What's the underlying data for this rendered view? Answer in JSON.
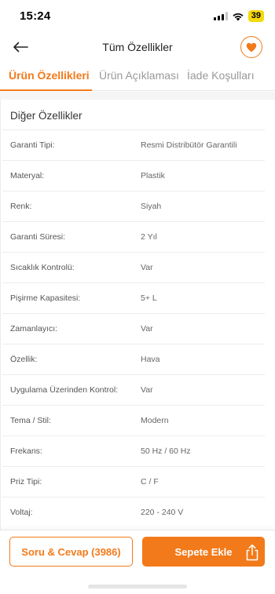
{
  "status_bar": {
    "time": "15:24",
    "battery": "39"
  },
  "header": {
    "title": "Tüm Özellikler"
  },
  "tabs": [
    {
      "label": "Ürün Özellikleri",
      "active": true
    },
    {
      "label": "Ürün Açıklaması",
      "active": false
    },
    {
      "label": "İade Koşulları",
      "active": false
    }
  ],
  "section": {
    "title": "Diğer Özellikler",
    "rows": [
      {
        "label": "Garanti Tipi:",
        "value": "Resmi Distribütör Garantili"
      },
      {
        "label": "Materyal:",
        "value": "Plastik"
      },
      {
        "label": "Renk:",
        "value": "Siyah"
      },
      {
        "label": "Garanti Süresi:",
        "value": "2 Yıl"
      },
      {
        "label": "Sıcaklık Kontrolü:",
        "value": "Var"
      },
      {
        "label": "Pişirme Kapasitesi:",
        "value": "5+ L"
      },
      {
        "label": "Zamanlayıcı:",
        "value": "Var"
      },
      {
        "label": "Özellik:",
        "value": "Hava"
      },
      {
        "label": "Uygulama Üzerinden Kontrol:",
        "value": "Var"
      },
      {
        "label": "Tema / Stil:",
        "value": "Modern"
      },
      {
        "label": "Frekans:",
        "value": "50 Hz / 60 Hz"
      },
      {
        "label": "Priz Tipi:",
        "value": "C / F"
      },
      {
        "label": "Voltaj:",
        "value": "220 - 240 V"
      }
    ]
  },
  "footer": {
    "qa_label": "Soru & Cevap (3986)",
    "cart_label": "Sepete Ekle"
  },
  "colors": {
    "accent": "#f27a1a",
    "battery": "#f5d90a"
  },
  "icons": {
    "back": "arrow-left-icon",
    "favorite": "heart-icon",
    "share": "share-icon",
    "signal": "signal-icon",
    "wifi": "wifi-icon"
  }
}
